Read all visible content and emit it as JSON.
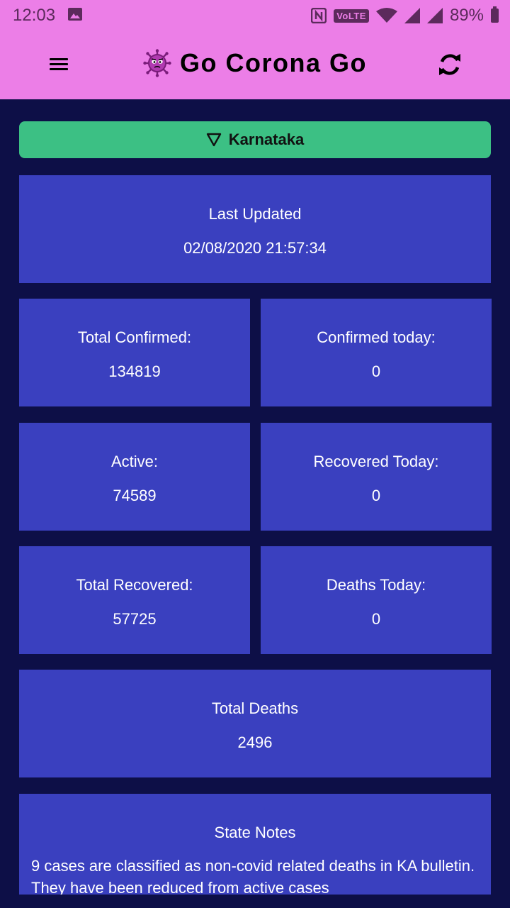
{
  "status_bar": {
    "time": "12:03",
    "network": "VoLTE",
    "battery": "89%"
  },
  "app_bar": {
    "title": "Go Corona Go"
  },
  "state_selector": {
    "selected": "Karnataka"
  },
  "last_updated": {
    "label": "Last Updated",
    "value": "02/08/2020 21:57:34"
  },
  "stats": {
    "total_confirmed": {
      "label": "Total Confirmed:",
      "value": "134819"
    },
    "confirmed_today": {
      "label": "Confirmed today:",
      "value": "0"
    },
    "active": {
      "label": "Active:",
      "value": "74589"
    },
    "recovered_today": {
      "label": "Recovered Today:",
      "value": "0"
    },
    "total_recovered": {
      "label": "Total Recovered:",
      "value": "57725"
    },
    "deaths_today": {
      "label": "Deaths Today:",
      "value": "0"
    },
    "total_deaths": {
      "label": "Total Deaths",
      "value": "2496"
    }
  },
  "state_notes": {
    "label": "State Notes",
    "text": "9 cases are classified as non-covid related deaths in KA bulletin. They have been reduced from active cases"
  },
  "colors": {
    "app_bar": "#ec7ee7",
    "background": "#0d0f47",
    "card": "#3a40bf",
    "selector": "#3cc084"
  }
}
